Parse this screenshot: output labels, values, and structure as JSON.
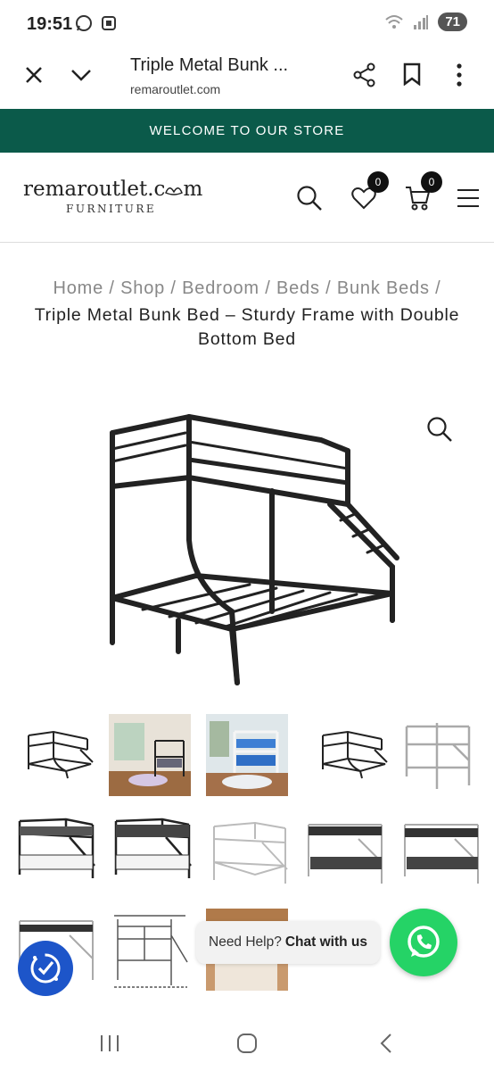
{
  "status_bar": {
    "time": "19:51",
    "battery": "71"
  },
  "browser": {
    "title": "Triple Metal Bunk ...",
    "url": "remaroutlet.com"
  },
  "banner": {
    "text": "WELCOME TO OUR STORE"
  },
  "site_header": {
    "logo_main": "remaroutlet.c",
    "logo_main_end": "m",
    "logo_sub": "FURNITURE",
    "wishlist_count": "0",
    "cart_count": "0"
  },
  "breadcrumb": {
    "items": [
      "Home",
      "Shop",
      "Bedroom",
      "Beds",
      "Bunk Beds"
    ],
    "separator": "/"
  },
  "product": {
    "title": "Triple Metal Bunk Bed – Sturdy Frame with Double Bottom Bed"
  },
  "chat": {
    "prefix": "Need Help?",
    "link": "Chat with us"
  },
  "colors": {
    "banner": "#0b5a4a",
    "whatsapp": "#25d366",
    "accessibility": "#1d55c9"
  },
  "icons": [
    "close-icon",
    "chevron-down-icon",
    "share-icon",
    "bookmark-icon",
    "more-icon",
    "search-icon",
    "heart-icon",
    "cart-icon",
    "menu-icon",
    "zoom-icon",
    "whatsapp-icon",
    "accessibility-icon"
  ]
}
